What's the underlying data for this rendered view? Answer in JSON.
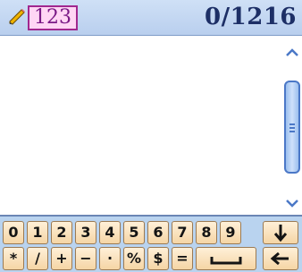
{
  "header": {
    "mode_label": "123",
    "counter": "0/1216"
  },
  "editor": {
    "text": ""
  },
  "keyboard": {
    "row1": [
      "0",
      "1",
      "2",
      "3",
      "4",
      "5",
      "6",
      "7",
      "8",
      "9"
    ],
    "row2": [
      "*",
      "/",
      "+",
      "−",
      "·",
      "%",
      "$",
      "="
    ],
    "icons": {
      "down": "down-arrow-icon",
      "space": "space-bar-icon",
      "backspace": "left-arrow-icon"
    }
  },
  "colors": {
    "header_bg": "#b9cfee",
    "badge_border": "#a1288f",
    "badge_bg": "#ffd6f4",
    "counter_text": "#1d2f66",
    "key_bg": "#f5d5a5",
    "keyboard_bg": "#b9d3ef",
    "scroll_thumb": "#9cc0ee"
  }
}
